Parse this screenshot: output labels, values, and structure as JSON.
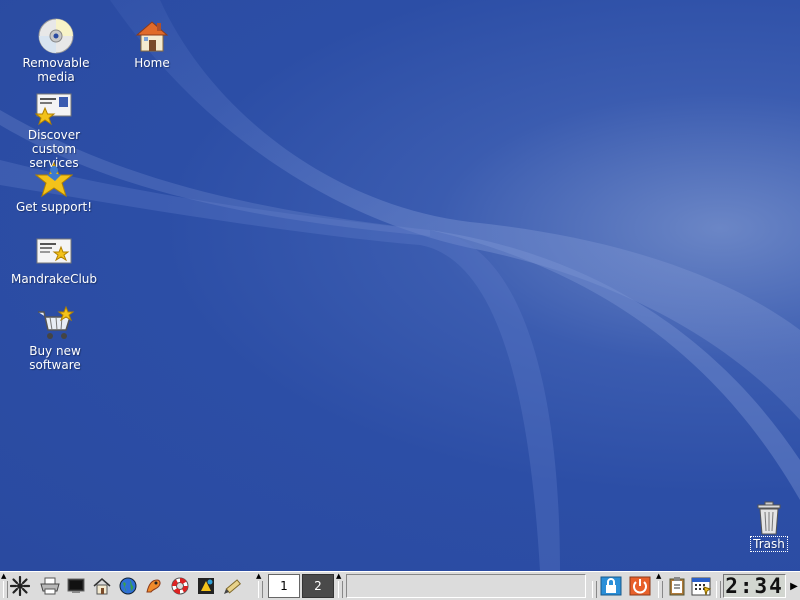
{
  "desktop": {
    "icons": [
      {
        "label": "Removable media",
        "icon": "cdrom-icon"
      },
      {
        "label": "Home",
        "icon": "home-folder-icon"
      },
      {
        "label": "Discover custom\nservices",
        "icon": "services-card-icon"
      },
      {
        "label": "Get support!",
        "icon": "support-star-icon"
      },
      {
        "label": "MandrakeClub",
        "icon": "mandrakeclub-card-icon"
      },
      {
        "label": "Buy new software",
        "icon": "shopping-cart-icon"
      },
      {
        "label": "Trash",
        "icon": "trash-icon"
      }
    ],
    "background_colors": {
      "base": "#2a4aa0",
      "highlight": "#6b86c6",
      "swoosh": "#4a6ac0"
    }
  },
  "taskbar": {
    "quick_launch": [
      "kde-menu-icon",
      "printer-icon",
      "terminal-icon",
      "home-icon",
      "browser-globe-icon",
      "mail-icon",
      "help-lifebuoy-icon",
      "office-icon",
      "editor-icon"
    ],
    "desktops": [
      "1",
      "2"
    ],
    "active_desktop": "1",
    "tray": [
      "lock-screen-icon",
      "logout-icon",
      "clipboard-icon",
      "calendar-icon"
    ],
    "clock": "2:34",
    "hide_arrow": "▶",
    "handle_arrow": "▲"
  }
}
